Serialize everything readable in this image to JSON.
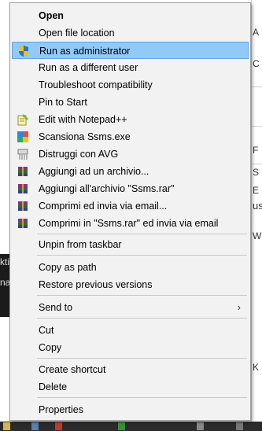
{
  "background": {
    "left_fragments": [
      "kti",
      "na"
    ],
    "right_fragments": [
      "A",
      "C",
      "F",
      "S",
      "E",
      "us",
      "W",
      "K"
    ]
  },
  "menu": {
    "items": [
      {
        "label": "Open",
        "icon": "none"
      },
      {
        "label": "Open file location",
        "icon": "none"
      },
      {
        "label": "Run as administrator",
        "icon": "uac-shield-icon"
      },
      {
        "label": "Run as a different user",
        "icon": "none"
      },
      {
        "label": "Troubleshoot compatibility",
        "icon": "none"
      },
      {
        "label": "Pin to Start",
        "icon": "none"
      },
      {
        "label": "Edit with Notepad++",
        "icon": "notepad-plus-plus-icon"
      },
      {
        "label": "Scansiona Ssms.exe",
        "icon": "malwarebytes-icon"
      },
      {
        "label": "Distruggi con AVG",
        "icon": "avg-shredder-icon"
      },
      {
        "label": "Aggiungi ad un archivio...",
        "icon": "winrar-icon"
      },
      {
        "label": "Aggiungi all'archivio \"Ssms.rar\"",
        "icon": "winrar-icon"
      },
      {
        "label": "Comprimi ed invia via email...",
        "icon": "winrar-icon"
      },
      {
        "label": "Comprimi in \"Ssms.rar\" ed invia via email",
        "icon": "winrar-icon"
      },
      {
        "label": "Unpin from taskbar",
        "icon": "none"
      },
      {
        "label": "Copy as path",
        "icon": "none"
      },
      {
        "label": "Restore previous versions",
        "icon": "none"
      },
      {
        "label": "Send to",
        "icon": "none",
        "submenu_arrow": "›"
      },
      {
        "label": "Cut",
        "icon": "none"
      },
      {
        "label": "Copy",
        "icon": "none"
      },
      {
        "label": "Create shortcut",
        "icon": "none"
      },
      {
        "label": "Delete",
        "icon": "none"
      },
      {
        "label": "Properties",
        "icon": "none"
      }
    ],
    "highlighted_item": "Run as administrator",
    "colors": {
      "menu_bg": "#f2f2f2",
      "highlight_bg": "#91c9f7",
      "highlight_border": "#5fa6e2",
      "separator": "#c8c8c8"
    }
  }
}
